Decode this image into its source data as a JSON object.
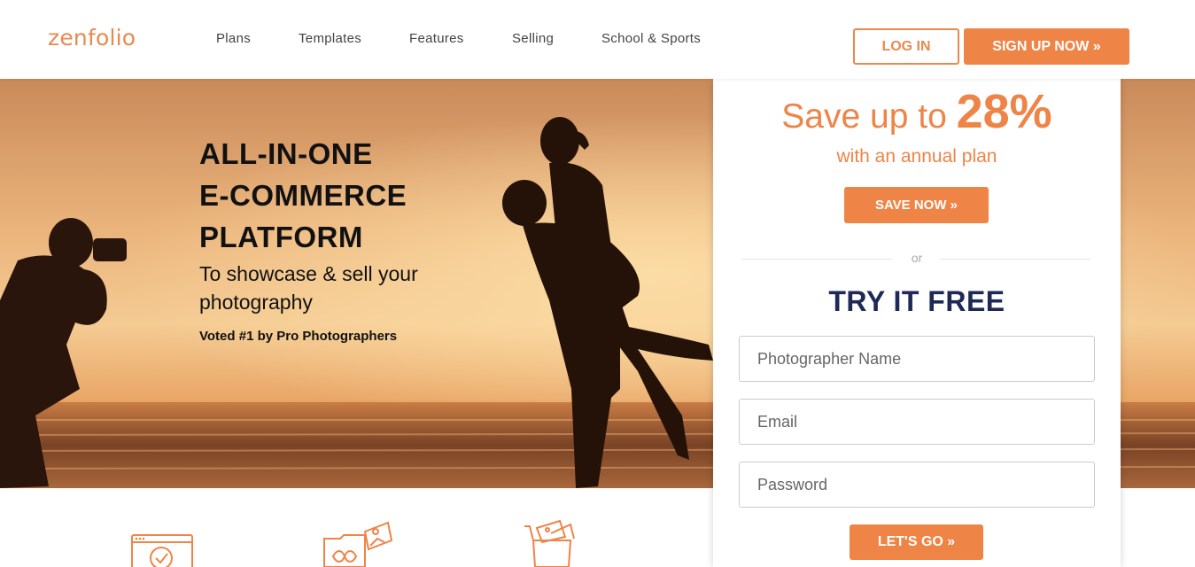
{
  "brand": {
    "logo_text": "zenfolio",
    "accent": "#ef8447",
    "navy": "#1e2a55"
  },
  "nav": {
    "items": [
      {
        "label": "Plans"
      },
      {
        "label": "Templates"
      },
      {
        "label": "Features"
      },
      {
        "label": "Selling"
      },
      {
        "label": "School & Sports"
      }
    ],
    "login_label": "LOG IN",
    "signup_label": "SIGN UP NOW »"
  },
  "hero": {
    "title_line1": "ALL-IN-ONE",
    "title_line2": "E-COMMERCE",
    "title_line3": "PLATFORM",
    "subtitle": "To showcase & sell your photography",
    "voted": "Voted #1 by Pro Photographers"
  },
  "signup_card": {
    "save_prefix": "Save up to ",
    "save_percent": "28%",
    "annual_text": "with an annual plan",
    "save_button": "SAVE NOW »",
    "or_text": "or",
    "try_title": "TRY IT FREE",
    "name_placeholder": "Photographer Name",
    "email_placeholder": "Email",
    "password_placeholder": "Password",
    "go_button": "LET'S GO »"
  },
  "features": {
    "icons": [
      "browser-check-icon",
      "folder-infinity-icon",
      "shopping-cart-icon"
    ]
  }
}
